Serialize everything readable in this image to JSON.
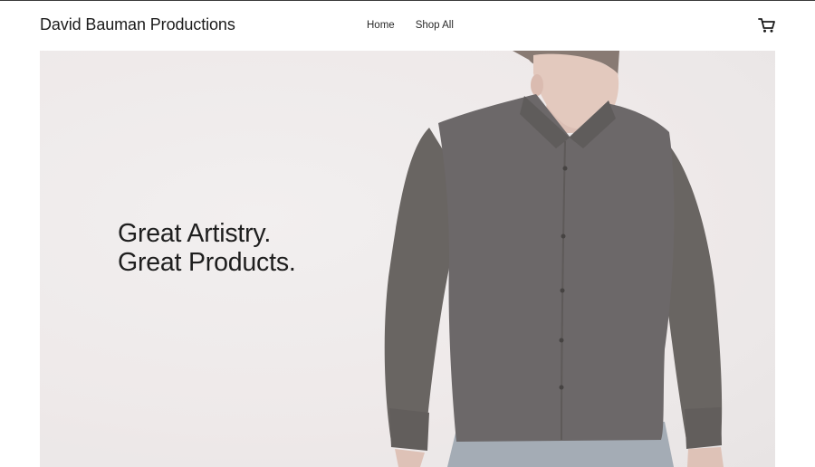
{
  "header": {
    "brand": "David Bauman Productions",
    "nav": [
      {
        "label": "Home"
      },
      {
        "label": "Shop All"
      }
    ],
    "cart_icon": "shopping-cart-icon"
  },
  "hero": {
    "headline_line1": "Great Artistry.",
    "headline_line2": "Great Products.",
    "image": "man-in-dark-shirt-photo"
  },
  "colors": {
    "hero_background": "#eee9e9",
    "shirt": "#5b5657",
    "text": "#1e1e1e"
  }
}
